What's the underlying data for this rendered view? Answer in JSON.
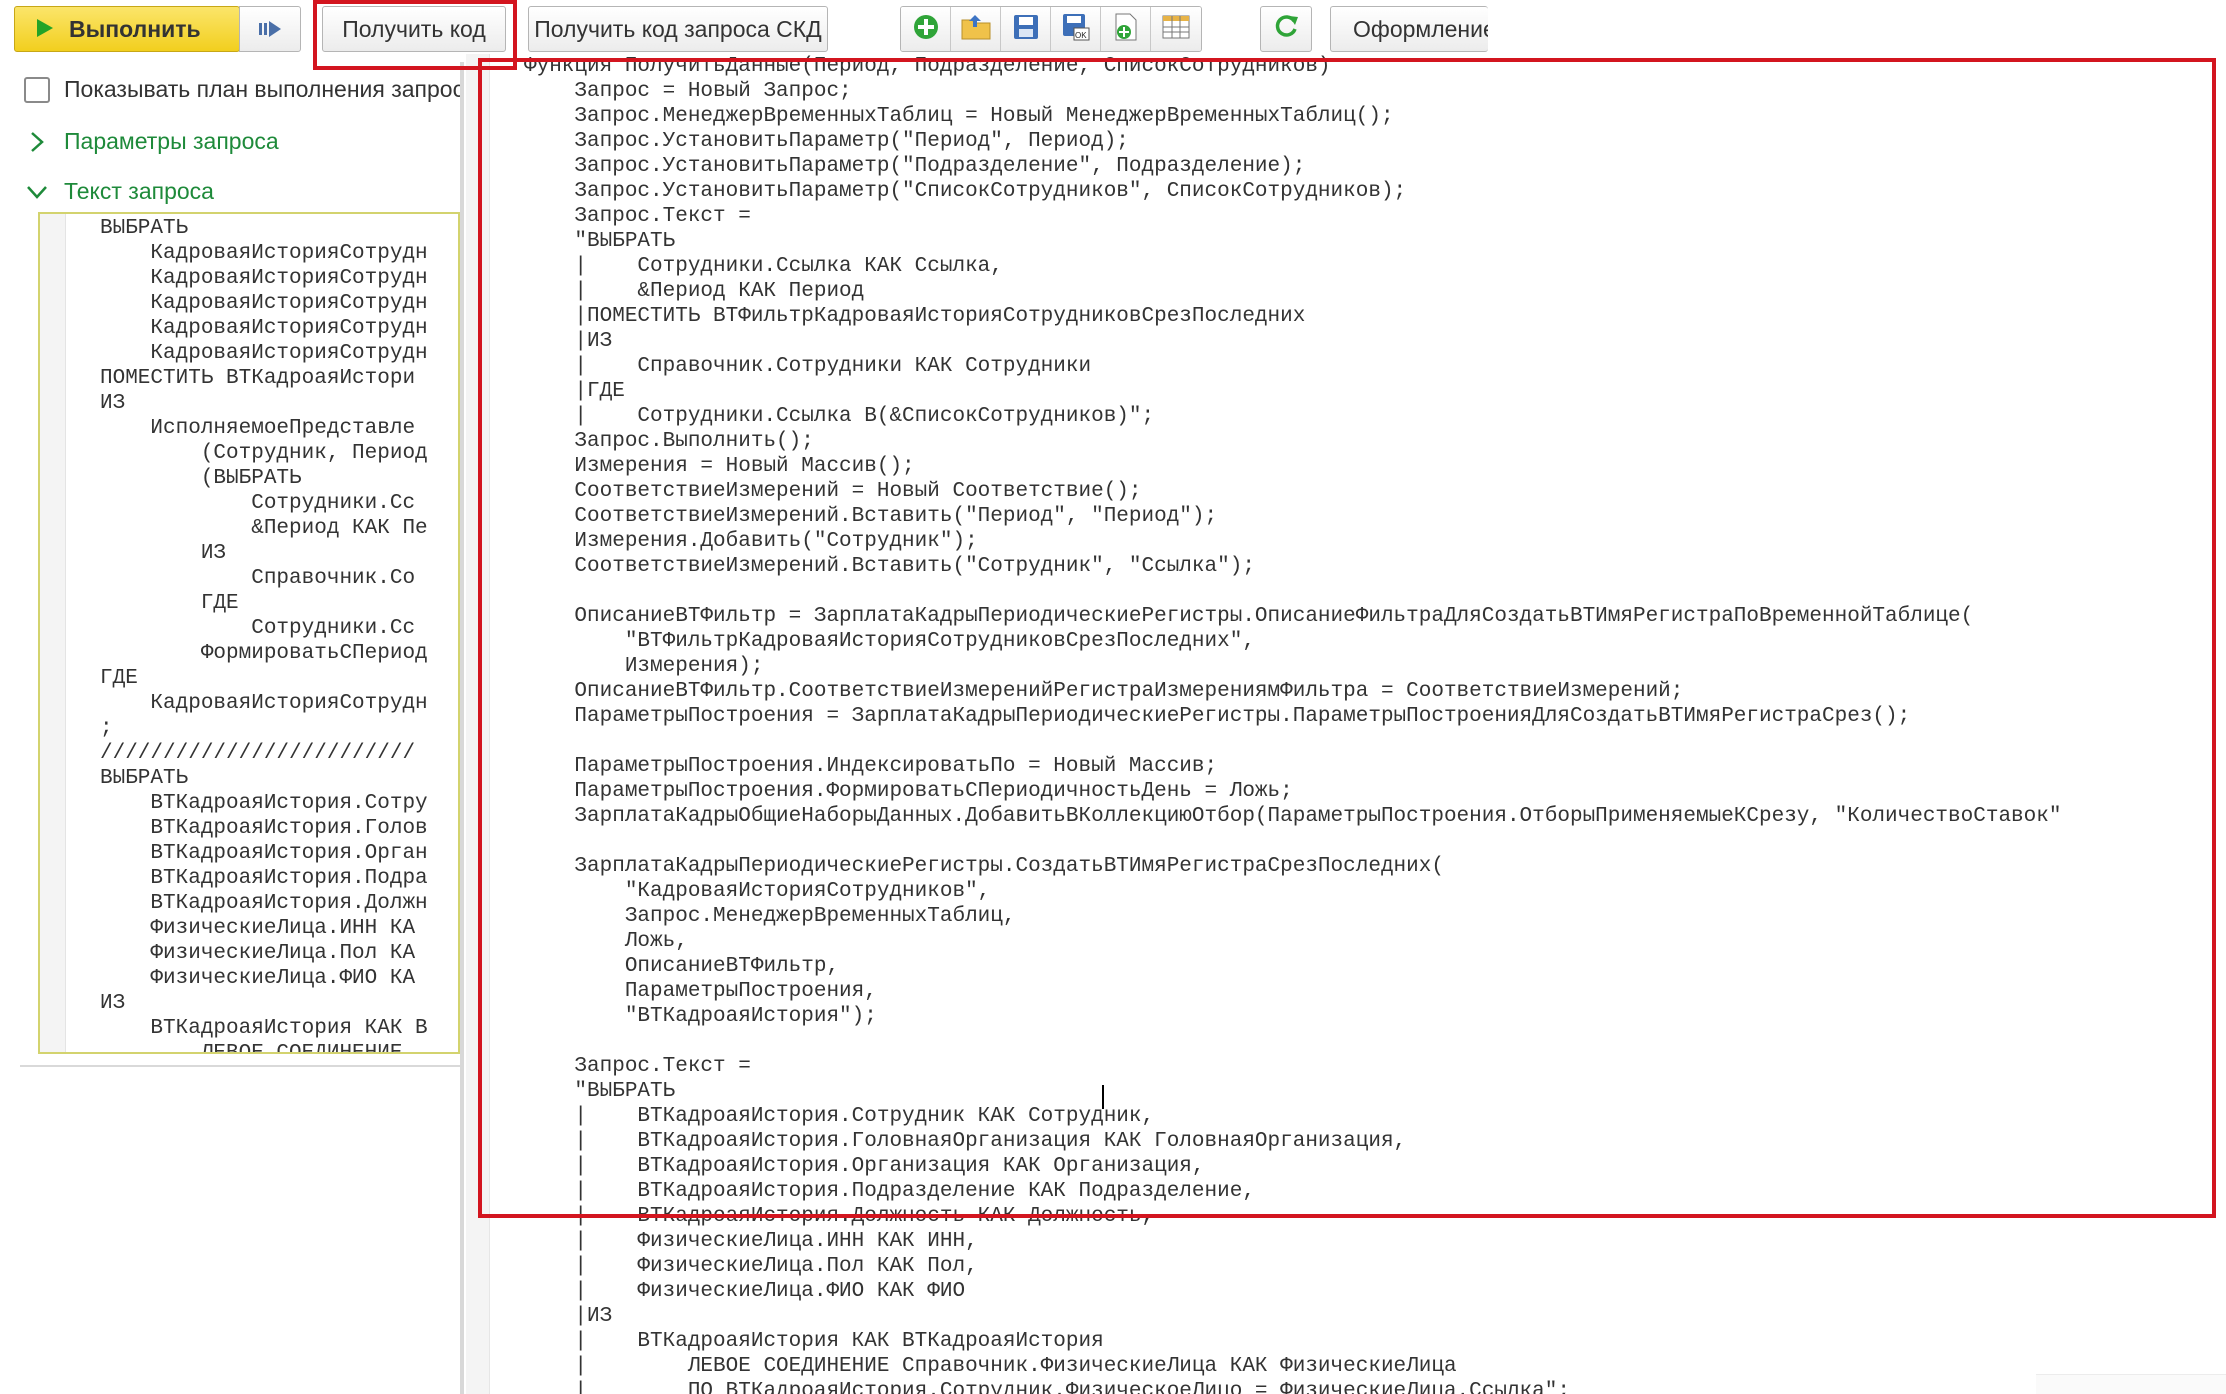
{
  "toolbar": {
    "run_label": "Выполнить",
    "get_code_label": "Получить код",
    "get_skd_label": "Получить код запроса СКД",
    "style_label": "Оформление",
    "icons": [
      "add-icon",
      "open-folder-icon",
      "save-icon",
      "save-as-icon",
      "new-file-icon",
      "table-icon"
    ],
    "refresh_icon": "refresh-icon",
    "colors": {
      "run_bg": "#f2cf1e",
      "run_arrow": "#24a327",
      "highlight": "#d3151f",
      "section": "#1e8a3a"
    }
  },
  "left": {
    "show_plan_label": "Показывать план выполнения запрос",
    "params_label": "Параметры запроса",
    "text_label": "Текст запроса",
    "query_lines": [
      "ВЫБРАТЬ",
      "    КадроваяИсторияСотрудн",
      "    КадроваяИсторияСотрудн",
      "    КадроваяИсторияСотрудн",
      "    КадроваяИсторияСотрудн",
      "    КадроваяИсторияСотрудн",
      "ПОМЕСТИТЬ ВТКадроаяИстори",
      "ИЗ",
      "    ИсполняемоеПредставле",
      "        (Сотрудник, Период",
      "        (ВЫБРАТЬ",
      "            Сотрудники.Сс",
      "            &Период КАК Пе",
      "        ИЗ",
      "            Справочник.Со",
      "        ГДЕ",
      "            Сотрудники.Сс",
      "        ФормироватьСПериод",
      "ГДЕ",
      "    КадроваяИсторияСотрудн",
      ";",
      "/////////////////////////",
      "ВЫБРАТЬ",
      "    ВТКадроаяИстория.Сотру",
      "    ВТКадроаяИстория.Голов",
      "    ВТКадроаяИстория.Орган",
      "    ВТКадроаяИстория.Подра",
      "    ВТКадроаяИстория.Должн",
      "    ФизическиеЛица.ИНН КА",
      "    ФизическиеЛица.Пол КА",
      "    ФизическиеЛица.ФИО КА",
      "ИЗ",
      "    ВТКадроаяИстория КАК В",
      "        ЛЕВОЕ СОЕДИНЕНИЕ"
    ]
  },
  "code": {
    "lines": [
      "Функция ПолучитьДанные(Период, Подразделение, СписокСотрудников)",
      "    Запрос = Новый Запрос;",
      "    Запрос.МенеджерВременныхТаблиц = Новый МенеджерВременныхТаблиц();",
      "    Запрос.УстановитьПараметр(\"Период\", Период);",
      "    Запрос.УстановитьПараметр(\"Подразделение\", Подразделение);",
      "    Запрос.УстановитьПараметр(\"СписокСотрудников\", СписокСотрудников);",
      "    Запрос.Текст =",
      "    \"ВЫБРАТЬ",
      "    |    Сотрудники.Ссылка КАК Ссылка,",
      "    |    &Период КАК Период",
      "    |ПОМЕСТИТЬ ВТФильтрКадроваяИсторияСотрудниковСрезПоследних",
      "    |ИЗ",
      "    |    Справочник.Сотрудники КАК Сотрудники",
      "    |ГДЕ",
      "    |    Сотрудники.Ссылка В(&СписокСотрудников)\";",
      "    Запрос.Выполнить();",
      "    Измерения = Новый Массив();",
      "    СоответствиеИзмерений = Новый Соответствие();",
      "    СоответствиеИзмерений.Вставить(\"Период\", \"Период\");",
      "    Измерения.Добавить(\"Сотрудник\");",
      "    СоответствиеИзмерений.Вставить(\"Сотрудник\", \"Ссылка\");",
      "",
      "    ОписаниеВТФильтр = ЗарплатаКадрыПериодическиеРегистры.ОписаниеФильтраДляСоздатьВТИмяРегистраПоВременнойТаблице(",
      "        \"ВТФильтрКадроваяИсторияСотрудниковСрезПоследних\",",
      "        Измерения);",
      "    ОписаниеВТФильтр.СоответствиеИзмеренийРегистраИзмерениямФильтра = СоответствиеИзмерений;",
      "    ПараметрыПостроения = ЗарплатаКадрыПериодическиеРегистры.ПараметрыПостроенияДляСоздатьВТИмяРегистраСрез();",
      "",
      "    ПараметрыПостроения.ИндексироватьПо = Новый Массив;",
      "    ПараметрыПостроения.ФормироватьСПериодичностьДень = Ложь;",
      "    ЗарплатаКадрыОбщиеНаборыДанных.ДобавитьВКоллекциюОтбор(ПараметрыПостроения.ОтборыПрименяемыеКСрезу, \"КоличествоСтавок\"",
      "",
      "    ЗарплатаКадрыПериодическиеРегистры.СоздатьВТИмяРегистраСрезПоследних(",
      "        \"КадроваяИсторияСотрудников\",",
      "        Запрос.МенеджерВременныхТаблиц,",
      "        Ложь,",
      "        ОписаниеВТФильтр,",
      "        ПараметрыПостроения,",
      "        \"ВТКадроаяИстория\");",
      "",
      "    Запрос.Текст =",
      "    \"ВЫБРАТЬ",
      "    |    ВТКадроаяИстория.Сотрудник КАК Сотрудник,",
      "    |    ВТКадроаяИстория.ГоловнаяОрганизация КАК ГоловнаяОрганизация,",
      "    |    ВТКадроаяИстория.Организация КАК Организация,",
      "    |    ВТКадроаяИстория.Подразделение КАК Подразделение,",
      "    |    ВТКадроаяИстория.Должность КАК Должность,",
      "    |    ФизическиеЛица.ИНН КАК ИНН,",
      "    |    ФизическиеЛица.Пол КАК Пол,",
      "    |    ФизическиеЛица.ФИО КАК ФИО",
      "    |ИЗ",
      "    |    ВТКадроаяИстория КАК ВТКадроаяИстория",
      "    |        ЛЕВОЕ СОЕДИНЕНИЕ Справочник.ФизическиеЛица КАК ФизическиеЛица",
      "    |        ПО ВТКадроаяИстория.Сотрудник.ФизическоеЛицо = ФизическиеЛица.Ссылка\";"
    ]
  }
}
